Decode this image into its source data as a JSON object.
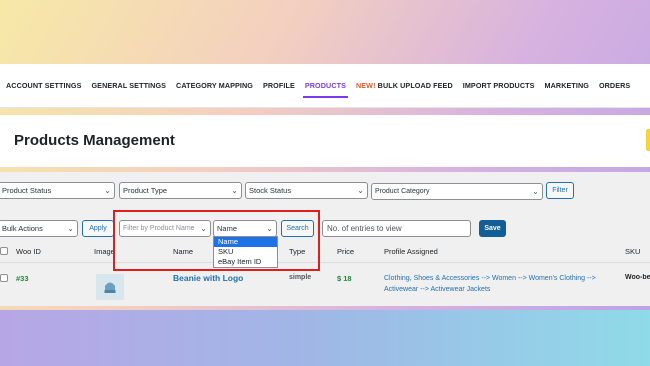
{
  "nav": {
    "items": [
      "ACCOUNT SETTINGS",
      "GENERAL SETTINGS",
      "CATEGORY MAPPING",
      "PROFILE",
      "PRODUCTS",
      "BULK UPLOAD FEED",
      "IMPORT PRODUCTS",
      "MARKETING",
      "ORDERS"
    ],
    "new_badge": "NEW!",
    "active": "PRODUCTS"
  },
  "page": {
    "title": "Products Management"
  },
  "filters": {
    "product_status": "Product Status",
    "product_type": "Product Type",
    "stock_status": "Stock Status",
    "product_category": "Product Category",
    "filter_button": "Filter"
  },
  "actions": {
    "bulk_actions": "Bulk Actions",
    "apply_button": "Apply",
    "filter_by_name_placeholder": "Filter by Product Name",
    "search_field_select": "Name",
    "search_button": "Search",
    "entries_placeholder": "No. of entries to view",
    "save_button": "Save"
  },
  "search_field_options": [
    "Name",
    "SKU",
    "eBay Item ID"
  ],
  "table": {
    "headers": [
      "Woo ID",
      "Image",
      "Name",
      "Type",
      "Price",
      "Profile Assigned",
      "SKU"
    ],
    "rows": [
      {
        "woo_id": "#33",
        "name": "Beanie with Logo",
        "type": "simple",
        "price_symbol": "$",
        "price": "18",
        "profile_line1": "Clothing, Shoes & Accessories --> Women --> Women's Clothing -->",
        "profile_line2": "Activewear --> Activewear Jackets",
        "sku": "Woo-be"
      }
    ]
  },
  "colors": {
    "accent_purple": "#7c3aed",
    "link_blue": "#2271b1",
    "primary_blue": "#135e96",
    "id_green": "#1e8a3b",
    "highlight_red": "#e01e1e",
    "new_orange": "#e05b2f"
  }
}
